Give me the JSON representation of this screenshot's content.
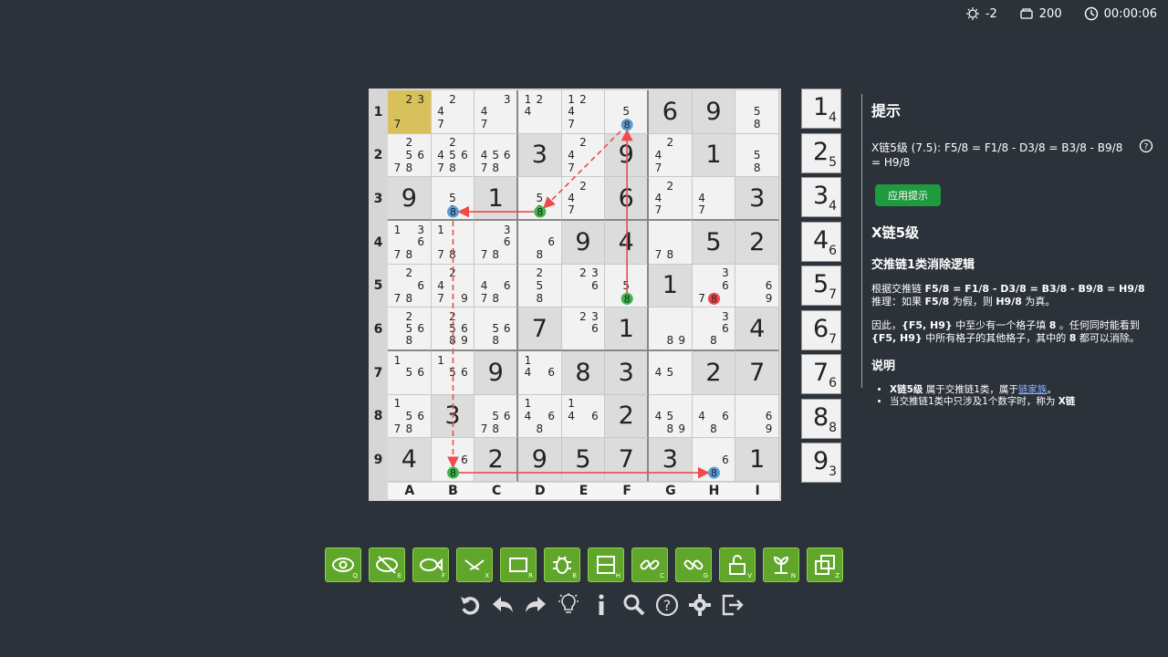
{
  "topbar": {
    "bulb_value": "-2",
    "coins_value": "200",
    "timer": "00:00:06"
  },
  "row_labels": [
    "1",
    "2",
    "3",
    "4",
    "5",
    "6",
    "7",
    "8",
    "9"
  ],
  "col_labels": [
    "A",
    "B",
    "C",
    "D",
    "E",
    "F",
    "G",
    "H",
    "I"
  ],
  "board": [
    [
      {
        "c": "237"
      },
      {
        "c": "247"
      },
      {
        "c": "347"
      },
      {
        "c": "124"
      },
      {
        "c": "1247"
      },
      {
        "c": "58"
      },
      {
        "v": "6"
      },
      {
        "v": "9"
      },
      {
        "c": "58"
      }
    ],
    [
      {
        "c": "25678"
      },
      {
        "c": "245678"
      },
      {
        "c": "45678"
      },
      {
        "v": "3"
      },
      {
        "c": "247"
      },
      {
        "v": "9"
      },
      {
        "c": "247"
      },
      {
        "v": "1"
      },
      {
        "c": "58"
      }
    ],
    [
      {
        "v": "9"
      },
      {
        "c": "58"
      },
      {
        "v": "1"
      },
      {
        "c": "58"
      },
      {
        "c": "247"
      },
      {
        "v": "6"
      },
      {
        "c": "247"
      },
      {
        "c": "47"
      },
      {
        "v": "3"
      }
    ],
    [
      {
        "c": "13678"
      },
      {
        "c": "178"
      },
      {
        "c": "3678"
      },
      {
        "c": "68"
      },
      {
        "v": "9"
      },
      {
        "v": "4"
      },
      {
        "c": "78"
      },
      {
        "v": "5"
      },
      {
        "v": "2"
      }
    ],
    [
      {
        "c": "2678"
      },
      {
        "c": "2479"
      },
      {
        "c": "4678"
      },
      {
        "c": "258"
      },
      {
        "c": "236"
      },
      {
        "c": "58"
      },
      {
        "v": "1"
      },
      {
        "c": "3678"
      },
      {
        "c": "69"
      }
    ],
    [
      {
        "c": "2568"
      },
      {
        "c": "25689"
      },
      {
        "c": "568"
      },
      {
        "v": "7"
      },
      {
        "c": "236"
      },
      {
        "v": "1"
      },
      {
        "c": "89"
      },
      {
        "c": "368"
      },
      {
        "v": "4"
      }
    ],
    [
      {
        "c": "156"
      },
      {
        "c": "156"
      },
      {
        "v": "9"
      },
      {
        "c": "146"
      },
      {
        "v": "8"
      },
      {
        "v": "3"
      },
      {
        "c": "45"
      },
      {
        "v": "2"
      },
      {
        "v": "7"
      }
    ],
    [
      {
        "c": "15678"
      },
      {
        "v": "3"
      },
      {
        "c": "5678"
      },
      {
        "c": "1468"
      },
      {
        "c": "146"
      },
      {
        "v": "2"
      },
      {
        "c": "4589"
      },
      {
        "c": "468"
      },
      {
        "c": "69"
      }
    ],
    [
      {
        "v": "4"
      },
      {
        "c": "68"
      },
      {
        "v": "2"
      },
      {
        "v": "9"
      },
      {
        "v": "5"
      },
      {
        "v": "7"
      },
      {
        "v": "3"
      },
      {
        "c": "68"
      },
      {
        "v": "1"
      }
    ]
  ],
  "selected_cell": "A1",
  "highlights": [
    {
      "cell": "F1",
      "digit": "8",
      "color": "#5b9bd5"
    },
    {
      "cell": "B3",
      "digit": "8",
      "color": "#5b9bd5"
    },
    {
      "cell": "D3",
      "digit": "8",
      "color": "#3cb54a"
    },
    {
      "cell": "F5",
      "digit": "8",
      "color": "#3cb54a"
    },
    {
      "cell": "H5",
      "digit": "8",
      "color": "#e8474c"
    },
    {
      "cell": "B9",
      "digit": "8",
      "color": "#3cb54a"
    },
    {
      "cell": "H9",
      "digit": "8",
      "color": "#5b9bd5"
    }
  ],
  "chain_links": [
    {
      "from": "F5",
      "to": "F1",
      "style": "solid"
    },
    {
      "from": "F1",
      "to": "D3",
      "style": "dashed"
    },
    {
      "from": "D3",
      "to": "B3",
      "style": "solid"
    },
    {
      "from": "B3",
      "to": "B9",
      "style": "dashed"
    },
    {
      "from": "B9",
      "to": "H9",
      "style": "solid"
    }
  ],
  "digit_counts": [
    {
      "digit": "1",
      "count": "4"
    },
    {
      "digit": "2",
      "count": "5"
    },
    {
      "digit": "3",
      "count": "4"
    },
    {
      "digit": "4",
      "count": "6"
    },
    {
      "digit": "5",
      "count": "7"
    },
    {
      "digit": "6",
      "count": "7"
    },
    {
      "digit": "7",
      "count": "6"
    },
    {
      "digit": "8",
      "count": "8"
    },
    {
      "digit": "9",
      "count": "3"
    }
  ],
  "hint": {
    "title": "提示",
    "chain": "X链5级 (7.5): F5/8 = F1/8 - D3/8 = B3/8 - B9/8 = H9/8",
    "apply_label": "应用提示",
    "technique": "X链5级",
    "subtitle": "交推链1类消除逻辑",
    "p1_prefix": "根据交推链 ",
    "p1_chain": "F5/8 = F1/8 - D3/8 = B3/8 - B9/8 = H9/8",
    "p1_line2a": "推理：如果 ",
    "p1_f5": "F5/8",
    "p1_line2b": " 为假，则 ",
    "p1_h9": "H9/8",
    "p1_line2c": " 为真。",
    "p2_a": "因此，",
    "p2_pair": "{F5, H9}",
    "p2_b": " 中至少有一个格子填 ",
    "p2_8": "8",
    "p2_c": " 。任何同时能看到 ",
    "p2_pair2": "{F5, H9}",
    "p2_d": " 中所有格子的其他格子，其中的 ",
    "p2_8b": "8",
    "p2_e": " 都可以消除。",
    "explain_title": "说明",
    "li1_a": "X链5级",
    "li1_b": " 属于交推链1类，属于",
    "li1_link": "链家族",
    "li1_c": "。",
    "li2_a": "当交推链1类中只涉及1个数字时，称为 ",
    "li2_b": "X链"
  },
  "tools": [
    {
      "name": "view-candidates",
      "key": "Q"
    },
    {
      "name": "hide-candidates",
      "key": "E"
    },
    {
      "name": "fish",
      "key": "F"
    },
    {
      "name": "x-wing",
      "key": "X"
    },
    {
      "name": "rectangle",
      "key": "R"
    },
    {
      "name": "bug",
      "key": "B"
    },
    {
      "name": "house",
      "key": "H"
    },
    {
      "name": "chain",
      "key": "C"
    },
    {
      "name": "grouped-chain",
      "key": "G"
    },
    {
      "name": "unlock",
      "key": "V"
    },
    {
      "name": "nice-loop",
      "key": "N"
    },
    {
      "name": "zone",
      "key": "Z"
    }
  ]
}
